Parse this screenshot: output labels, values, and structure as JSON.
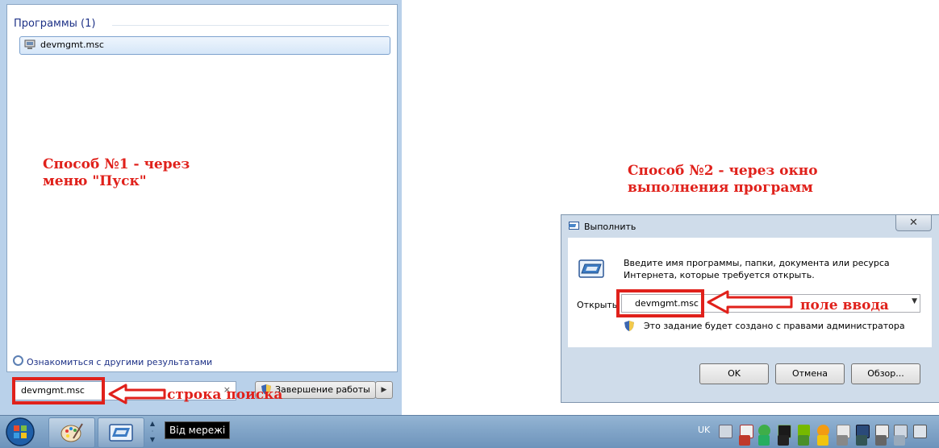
{
  "start_menu": {
    "group_header": "Программы (1)",
    "program_item": "devmgmt.msc",
    "more_results": "Ознакомиться с другими результатами",
    "search_value": "devmgmt.msc",
    "search_clear": "×",
    "shutdown_label": "Завершение работы"
  },
  "annotations": {
    "method1_line1": "Способ №1 - через",
    "method1_line2": "меню \"Пуск\"",
    "method2_line1": "Способ №2 - через окно",
    "method2_line2": "выполнения программ",
    "search_label": "строка поиска",
    "input_label": "поле ввода"
  },
  "run_dialog": {
    "title": "Выполнить",
    "close": "✕",
    "description": "Введите имя программы, папки, документа или ресурса Интернета, которые требуется открыть.",
    "open_label": "Открыть:",
    "open_value": "devmgmt.msc",
    "admin_note": "Это задание будет создано с правами администратора",
    "ok": "OK",
    "cancel": "Отмена",
    "browse": "Обзор..."
  },
  "taskbar": {
    "network_tooltip": "Від мережі",
    "language": "UK"
  },
  "icons": [
    "windows-orb-icon",
    "paint-icon",
    "run-icon",
    "gear-icon",
    "flag-icon",
    "shield-icon",
    "monitor-icon",
    "nvidia-icon",
    "update-icon",
    "network-icon",
    "volume-icon"
  ],
  "colors": {
    "annotation_red": "#e0211b",
    "taskbar": "#7fa3c8"
  }
}
